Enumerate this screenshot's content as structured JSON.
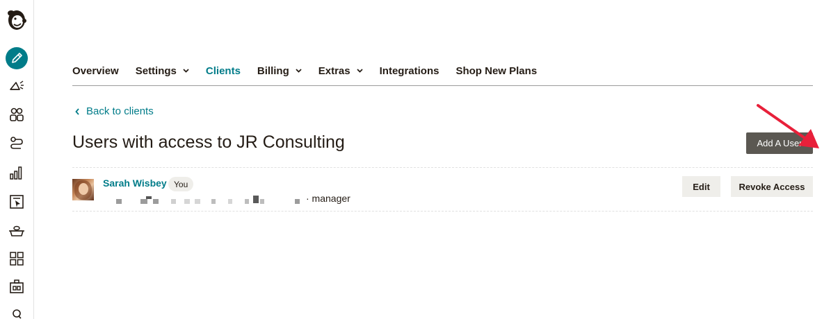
{
  "sidebar": {
    "items": [
      {
        "icon": "freddie-logo-icon"
      },
      {
        "icon": "pencil-create-icon",
        "accent": "#007c89"
      },
      {
        "icon": "megaphone-icon"
      },
      {
        "icon": "audience-icon"
      },
      {
        "icon": "automations-icon"
      },
      {
        "icon": "analytics-icon"
      },
      {
        "icon": "website-icon"
      },
      {
        "icon": "content-icon"
      },
      {
        "icon": "integrations-grid-icon"
      },
      {
        "icon": "briefcase-icon"
      },
      {
        "icon": "search-icon"
      }
    ]
  },
  "nav": {
    "overview": "Overview",
    "settings": "Settings",
    "clients": "Clients",
    "billing": "Billing",
    "extras": "Extras",
    "integrations": "Integrations",
    "shop": "Shop New Plans"
  },
  "back_link": "Back to clients",
  "page_title": "Users with access to JR Consulting",
  "add_user_label": "Add A User",
  "users": [
    {
      "name": "Sarah Wisbey",
      "badge": "You",
      "role": "· manager",
      "edit_label": "Edit",
      "revoke_label": "Revoke Access"
    }
  ],
  "colors": {
    "accent": "#007c89",
    "primary_button": "#5b5852",
    "secondary_button": "#efeeea",
    "annotation_arrow": "#e8203a"
  }
}
